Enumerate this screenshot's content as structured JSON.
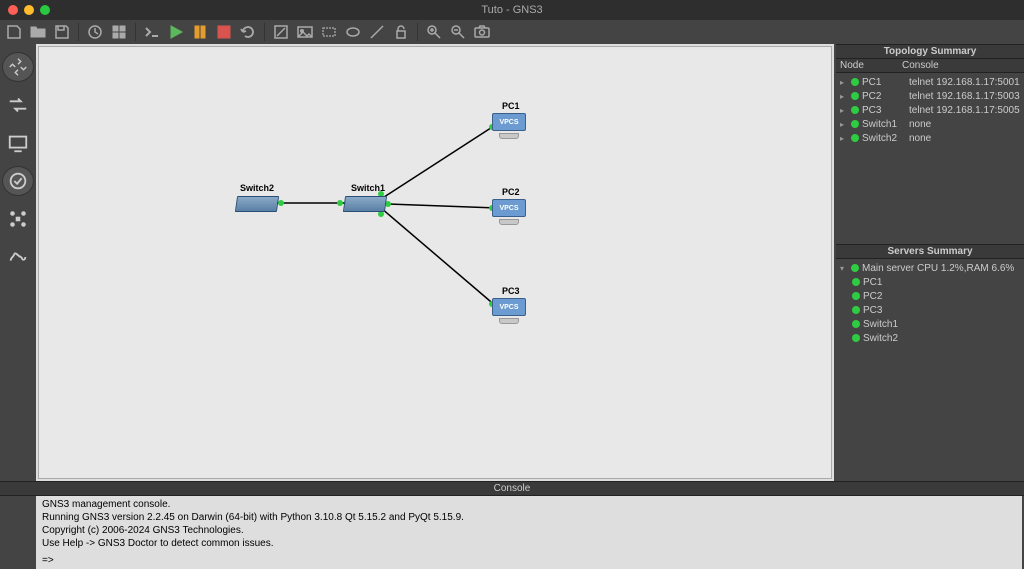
{
  "window": {
    "title": "Tuto - GNS3"
  },
  "topology": {
    "panel_title": "Topology Summary",
    "header_node": "Node",
    "header_console": "Console",
    "nodes": [
      {
        "name": "PC1",
        "console": "telnet 192.168.1.17:5001"
      },
      {
        "name": "PC2",
        "console": "telnet 192.168.1.17:5003"
      },
      {
        "name": "PC3",
        "console": "telnet 192.168.1.17:5005"
      },
      {
        "name": "Switch1",
        "console": "none"
      },
      {
        "name": "Switch2",
        "console": "none"
      }
    ]
  },
  "servers": {
    "panel_title": "Servers Summary",
    "main": "Main server CPU 1.2%,RAM 6.6%",
    "children": [
      {
        "name": "PC1"
      },
      {
        "name": "PC2"
      },
      {
        "name": "PC3"
      },
      {
        "name": "Switch1"
      },
      {
        "name": "Switch2"
      }
    ]
  },
  "console": {
    "title": "Console",
    "line0": "GNS3 management console.",
    "line1": "Running GNS3 version 2.2.45 on Darwin (64-bit) with Python 3.10.8 Qt 5.15.2 and PyQt 5.15.9.",
    "line2": "Copyright (c) 2006-2024 GNS3 Technologies.",
    "line3": "Use Help -> GNS3 Doctor to detect common issues.",
    "prompt": "=>"
  },
  "canvas": {
    "vpcs_label": "VPCS",
    "pc1_label": "PC1",
    "pc2_label": "PC2",
    "pc3_label": "PC3",
    "switch1_label": "Switch1",
    "switch2_label": "Switch2"
  }
}
